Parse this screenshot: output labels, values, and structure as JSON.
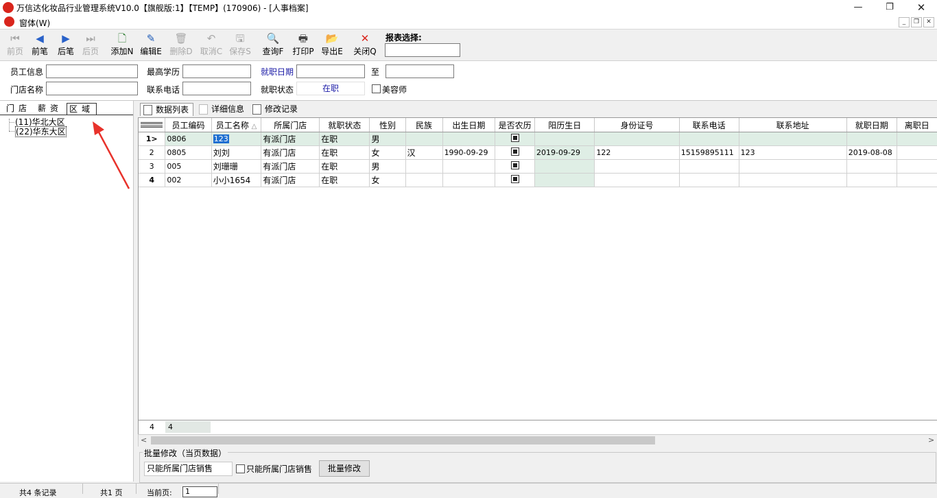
{
  "window": {
    "title": "万信达化妆品行业管理系统V10.0【旗舰版:1】【TEMP】(170906) - [人事档案]",
    "menu": "窗体(W)"
  },
  "toolbar": {
    "first": "前页",
    "prev": "前笔",
    "next": "后笔",
    "last": "后页",
    "add": "添加N",
    "edit": "编辑E",
    "delete": "删除D",
    "cancel": "取消C",
    "save": "保存S",
    "query": "查询F",
    "print": "打印P",
    "export": "导出E",
    "close": "关闭Q",
    "report_label": "报表选择:"
  },
  "filters": {
    "employee_info": "员工信息",
    "education": "最高学历",
    "hire_date": "就职日期",
    "to": "至",
    "store_name": "门店名称",
    "phone": "联系电话",
    "employ_status": "就职状态",
    "employ_status_value": "在职",
    "beautician": "美容师"
  },
  "left_tabs": [
    "门店",
    "薪资",
    "区域"
  ],
  "tree": [
    "(11)华北大区",
    "(22)华东大区"
  ],
  "right_tabs": [
    "数据列表",
    "详细信息",
    "修改记录"
  ],
  "grid": {
    "columns": [
      "员工编码",
      "员工名称",
      "所属门店",
      "就职状态",
      "性别",
      "民族",
      "出生日期",
      "是否农历",
      "阳历生日",
      "身份证号",
      "联系电话",
      "联系地址",
      "就职日期",
      "离职日"
    ],
    "rows": [
      {
        "no": "1",
        "code": "0806",
        "name": "123",
        "store": "有派门店",
        "status": "在职",
        "gender": "男",
        "nation": "",
        "birth": "",
        "solar_birth": "",
        "id_no": "",
        "phone": "",
        "address": "",
        "hire": "",
        "leave": ""
      },
      {
        "no": "2",
        "code": "0805",
        "name": "刘刘",
        "store": "有派门店",
        "status": "在职",
        "gender": "女",
        "nation": "汉",
        "birth": "1990-09-29",
        "solar_birth": "2019-09-29",
        "id_no": "122",
        "phone": "15159895111",
        "address": "123",
        "hire": "2019-08-08",
        "leave": ""
      },
      {
        "no": "3",
        "code": "005",
        "name": "刘珊珊",
        "store": "有派门店",
        "status": "在职",
        "gender": "男",
        "nation": "",
        "birth": "",
        "solar_birth": "",
        "id_no": "",
        "phone": "",
        "address": "",
        "hire": "",
        "leave": ""
      },
      {
        "no": "4",
        "code": "002",
        "name": "小小1654",
        "store": "有派门店",
        "status": "在职",
        "gender": "女",
        "nation": "",
        "birth": "",
        "solar_birth": "",
        "id_no": "",
        "phone": "",
        "address": "",
        "hire": "",
        "leave": ""
      }
    ],
    "footer_count": "4",
    "footer_value": "4"
  },
  "batch": {
    "title": "批量修改（当页数据）",
    "field_value": "只能所属门店销售",
    "checkbox_label": "只能所属门店销售",
    "button": "批量修改"
  },
  "status": {
    "records": "共4 条记录",
    "pages": "共1 页",
    "current_page_label": "当前页:",
    "current_page": "1"
  },
  "colors": {
    "accent_red": "#d9251c",
    "selection_green": "#dfeee5",
    "link_blue": "#1a1aa6"
  }
}
